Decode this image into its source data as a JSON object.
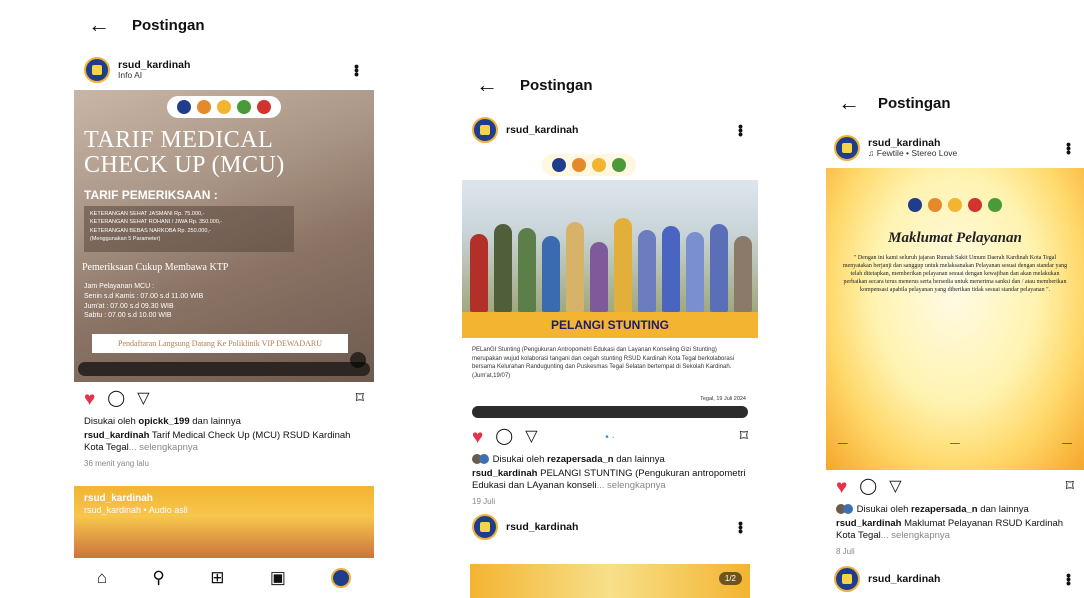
{
  "post1": {
    "title": "Postingan",
    "username": "rsud_kardinah",
    "subtitle": "Info AI",
    "media": {
      "title_line1": "TARIF MEDICAL",
      "title_line2": "CHECK UP (MCU)",
      "tarif_heading": "TARIF PEMERIKSAAN :",
      "tarif_items": [
        "KETERANGAN SEHAT JASMANI   Rp. 75.000,-",
        "KETERANGAN SEHAT ROHANI / JIWA   Rp. 350.000,-",
        "KETERANGAN BEBAS NARKOBA   Rp. 250.000,-",
        "(Menggunakan 5 Parameter)"
      ],
      "ktp_note": "Pemeriksaan Cukup Membawa KTP",
      "jam_heading": "Jam Pelayanan MCU :",
      "jam_items": [
        "Senin s.d Kamis : 07.00 s.d 11.00 WIB",
        "Jum'at : 07.00 s.d 09.30 WIB",
        "Sabtu : 07.00 s.d 10.00 WIB"
      ],
      "daftar_note": "Pendaftaran Langsung Datang Ke Poliklinik VIP DEWADARU"
    },
    "liked_by_prefix": "Disukai oleh ",
    "liked_by_user": "opickk_199",
    "liked_by_suffix": " dan lainnya",
    "caption_user": "rsud_kardinah",
    "caption_text": " Tarif Medical Check Up (MCU) RSUD Kardinah Kota Tegal",
    "more_label": "... selengkapnya",
    "time": "36 menit yang lalu",
    "reel": {
      "username": "rsud_kardinah",
      "audio": "rsud_kardinah • Audio asli"
    }
  },
  "post2": {
    "title": "Postingan",
    "username": "rsud_kardinah",
    "media": {
      "banner": "PELANGI STUNTING",
      "body": "PELanGI Stunting (Pengukuran Antropometri Edukasi dan Layanan Konseling Gizi Stunting) merupakan wujud kolaborasi tangani dan cegah stunting RSUD Kardinah Kota Tegal berkolaborasi bersama Kelurahan Randugunting dan Puskesmas Tegal Selatan bertempat di Sekolah Kardinah. (Jum'at,19/07)",
      "date": "Tegal, 19 Juli 2024"
    },
    "liked_by_prefix": "Disukai oleh ",
    "liked_by_user": "rezapersada_n",
    "liked_by_suffix": " dan lainnya",
    "caption_user": "rsud_kardinah",
    "caption_text": " PELANGI STUNTING (Pengukuran antropometri Edukasi dan LAyanan konseli",
    "more_label": "... selengkapnya",
    "time": "19 Juli",
    "next_username": "rsud_kardinah",
    "pager": "1/2"
  },
  "post3": {
    "title": "Postingan",
    "username": "rsud_kardinah",
    "subtitle": "Fewtile • Stereo Love",
    "media": {
      "heading": "Maklumat Pelayanan",
      "body": "\" Dengan ini kami seluruh jajaran Rumah Sakit Umum Daerah Kardinah Kota Tegal menyatakan berjanji dan sanggup untuk melaksanakan Pelayanan sesuai dengan standar yang telah ditetapkan, memberikan pelayanan sesuai dengan kewajiban dan akan melakukan perbaikan secara terus menerus serta bersedia untuk menerima sanksi dan / atau memberikan kompensasi apabila pelayanan yang diberikan tidak sesuai standar pelayanan \"."
    },
    "liked_by_prefix": "Disukai oleh ",
    "liked_by_user": "rezapersada_n",
    "liked_by_suffix": " dan lainnya",
    "caption_user": "rsud_kardinah",
    "caption_text": " Maklumat Pelayanan RSUD Kardinah Kota Tegal",
    "more_label": "... selengkapnya",
    "time": "8 Juli",
    "next_username": "rsud_kardinah"
  },
  "icons": {
    "back": "←",
    "more": "⋮",
    "heart": "♥",
    "comment": "◯",
    "share": "▽",
    "bookmark": "⌑",
    "home": "⌂",
    "search": "⚲",
    "add": "⊞",
    "reels": "▣"
  },
  "colors": {
    "like": "#e4324a",
    "accent_gold": "#f3b431",
    "navy": "#1f3d8a"
  }
}
